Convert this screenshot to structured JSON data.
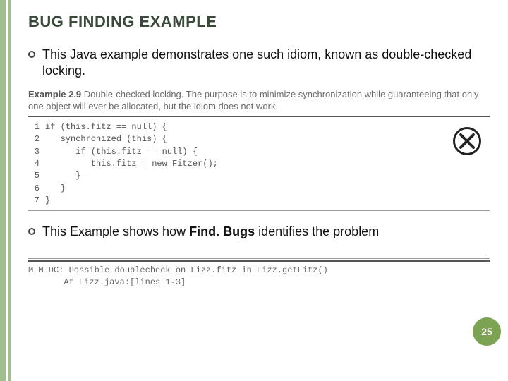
{
  "title": "BUG FINDING EXAMPLE",
  "bullets": {
    "first": "This Java example demonstrates one such idiom, known as double-checked locking.",
    "second_pre": "This Example shows how ",
    "second_bold": "Find. Bugs",
    "second_post": " identifies the problem"
  },
  "example": {
    "lead": "Example 2.9",
    "caption_rest": " Double-checked locking. The purpose is to minimize synchronization while guaranteeing that only one object will ever be allocated, but the idiom does not work."
  },
  "code": [
    {
      "n": "1",
      "t": "if (this.fitz == null) {"
    },
    {
      "n": "2",
      "t": "   synchronized (this) {"
    },
    {
      "n": "3",
      "t": "      if (this.fitz == null) {"
    },
    {
      "n": "4",
      "t": "         this.fitz = new Fitzer();"
    },
    {
      "n": "5",
      "t": "      }"
    },
    {
      "n": "6",
      "t": "   }"
    },
    {
      "n": "7",
      "t": "}"
    }
  ],
  "output": {
    "l1": "M M DC: Possible doublecheck on Fizz.fitz in Fizz.getFitz()",
    "l2": "       At Fizz.java:[lines 1-3]"
  },
  "page": "25",
  "icons": {
    "x": "x-mark"
  }
}
